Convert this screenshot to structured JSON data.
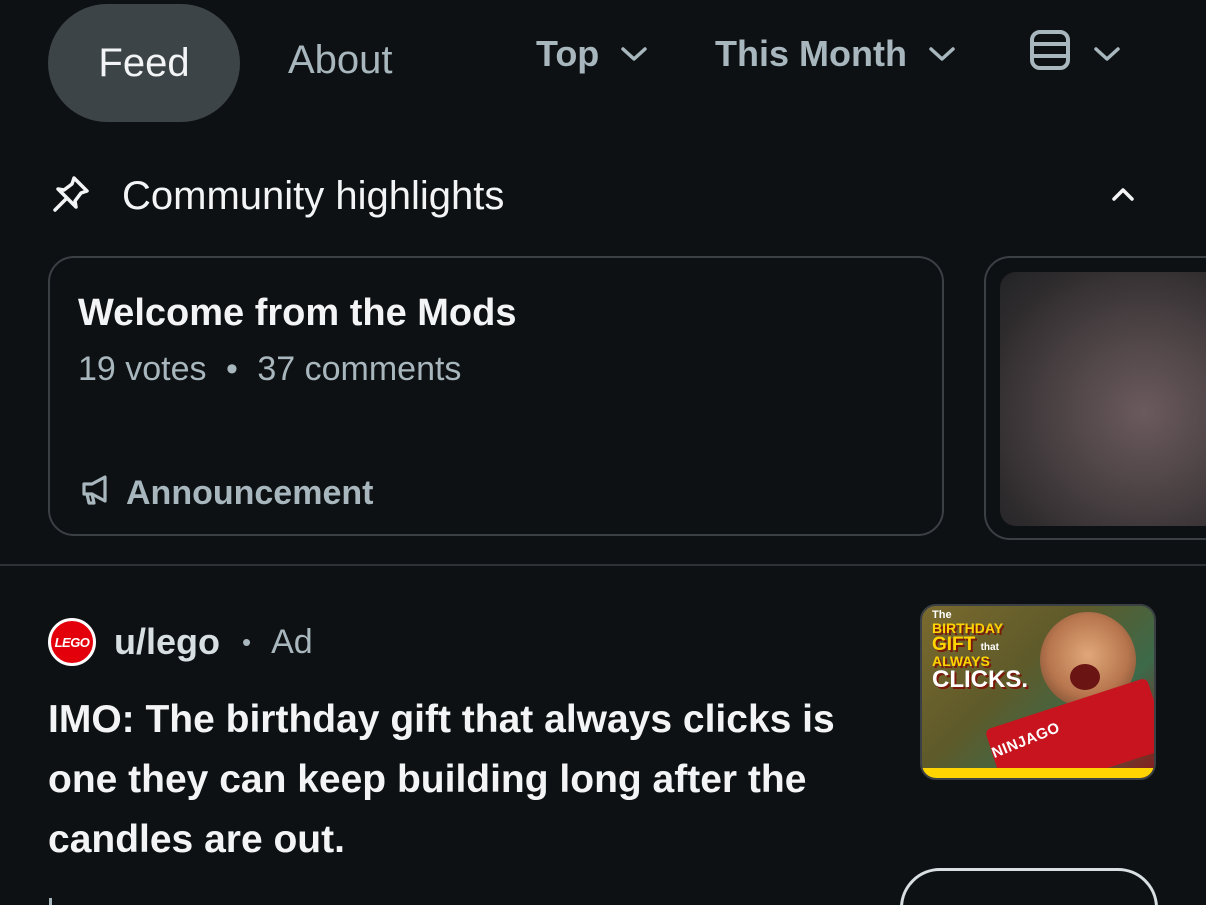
{
  "tabs": {
    "feed_label": "Feed",
    "about_label": "About"
  },
  "filters": {
    "sort_label": "Top",
    "time_label": "This Month"
  },
  "highlights": {
    "title": "Community highlights",
    "cards": [
      {
        "title": "Welcome from the Mods",
        "votes": "19 votes",
        "separator": "•",
        "comments": "37 comments",
        "tag": "Announcement"
      }
    ]
  },
  "post": {
    "avatar_text": "LEGO",
    "username": "u/lego",
    "separator": "•",
    "ad_label": "Ad",
    "title": "IMO: The birthday gift that always clicks is one they can keep building long after the candles are out.",
    "thumbnail": {
      "line1": "The",
      "line2": "BIRTHDAY",
      "line3": "GIFT",
      "line3_small": "that",
      "line4": "ALWAYS",
      "line5": "CLICKS.",
      "box_label": "NINJAGO"
    }
  },
  "colors": {
    "background": "#0e1113",
    "tab_active_bg": "#3c4447",
    "muted_text": "#a8b6bd",
    "primary_text": "#f2f4f5",
    "lego_red": "#e3000b"
  }
}
